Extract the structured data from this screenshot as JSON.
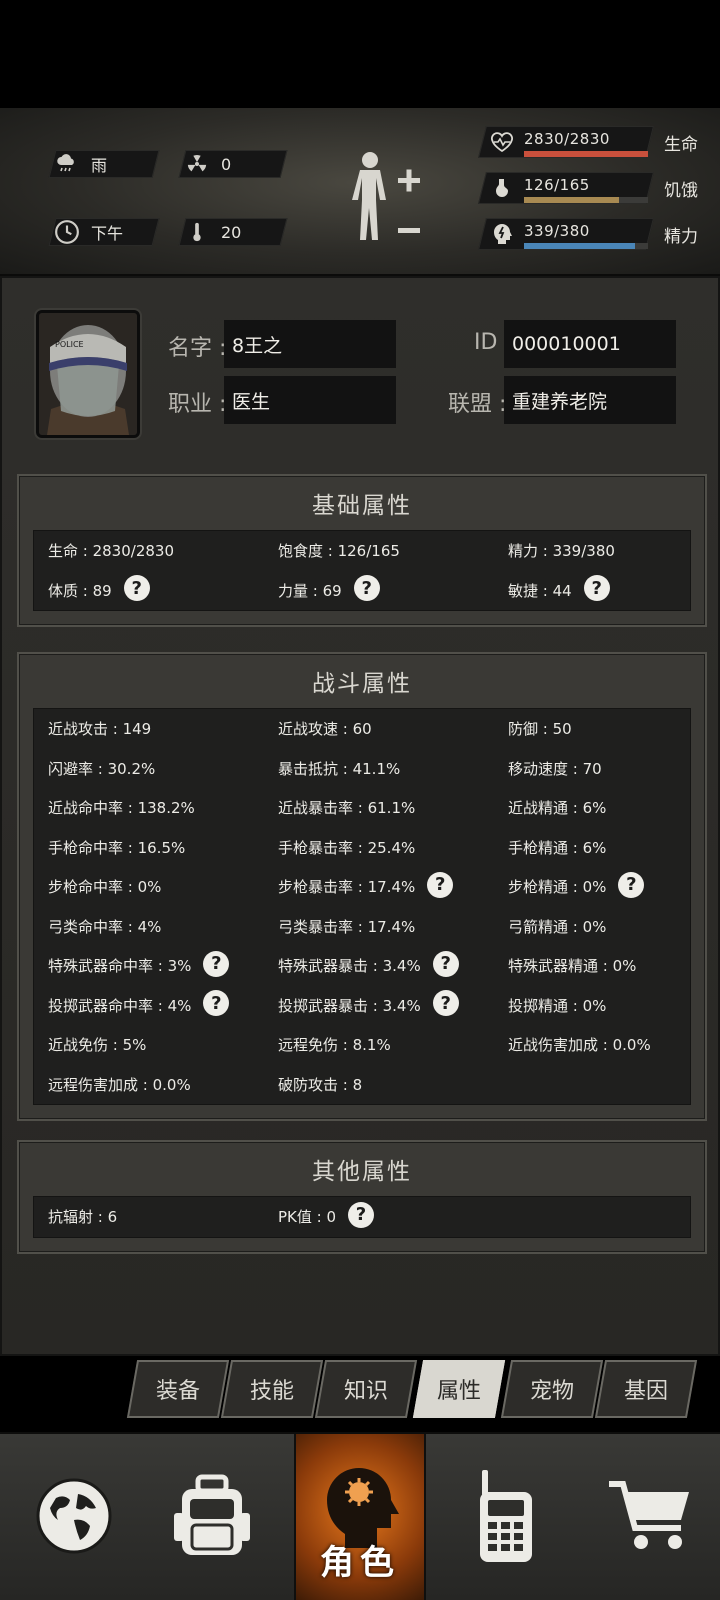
{
  "hud": {
    "weather": {
      "icon": "rain-cloud-icon",
      "value": "雨"
    },
    "radiation": {
      "icon": "radiation-icon",
      "value": "0"
    },
    "time": {
      "icon": "clock-icon",
      "value": "下午"
    },
    "temperature": {
      "icon": "thermometer-icon",
      "value": "20"
    },
    "stats": [
      {
        "icon": "heart-pulse-icon",
        "value": "2830/2830",
        "label": "生命",
        "current": 2830,
        "max": 2830,
        "color": "#c9503c"
      },
      {
        "icon": "stomach-icon",
        "value": "126/165",
        "label": "饥饿",
        "current": 126,
        "max": 165,
        "color": "#a88a52"
      },
      {
        "icon": "energy-head-icon",
        "value": "339/380",
        "label": "精力",
        "current": 339,
        "max": 380,
        "color": "#4a86b8"
      }
    ]
  },
  "profile": {
    "name_label": "名字",
    "name": "8王之",
    "id_label": "ID",
    "id": "000010001",
    "job_label": "职业",
    "job": "医生",
    "alliance_label": "联盟",
    "alliance": "重建养老院"
  },
  "basic": {
    "title": "基础属性",
    "rows": [
      [
        {
          "text": "生命 : 2830/2830",
          "help": false
        },
        {
          "text": "饱食度 : 126/165",
          "help": false
        },
        {
          "text": "精力 : 339/380",
          "help": false
        }
      ],
      [
        {
          "text": "体质 : 89",
          "help": true
        },
        {
          "text": "力量 : 69",
          "help": true
        },
        {
          "text": "敏捷 : 44",
          "help": true
        }
      ]
    ]
  },
  "combat": {
    "title": "战斗属性",
    "rows": [
      [
        {
          "text": "近战攻击 : 149",
          "help": false
        },
        {
          "text": "近战攻速 : 60",
          "help": false
        },
        {
          "text": "防御 : 50",
          "help": false
        }
      ],
      [
        {
          "text": "闪避率 : 30.2%",
          "help": false
        },
        {
          "text": "暴击抵抗 : 41.1%",
          "help": false
        },
        {
          "text": "移动速度 : 70",
          "help": false
        }
      ],
      [
        {
          "text": "近战命中率 : 138.2%",
          "help": false
        },
        {
          "text": "近战暴击率 : 61.1%",
          "help": false
        },
        {
          "text": "近战精通 : 6%",
          "help": false
        }
      ],
      [
        {
          "text": "手枪命中率 : 16.5%",
          "help": false
        },
        {
          "text": "手枪暴击率 : 25.4%",
          "help": false
        },
        {
          "text": "手枪精通 : 6%",
          "help": false
        }
      ],
      [
        {
          "text": "步枪命中率 : 0%",
          "help": false
        },
        {
          "text": "步枪暴击率 : 17.4%",
          "help": true
        },
        {
          "text": "步枪精通 : 0%",
          "help": true
        }
      ],
      [
        {
          "text": "弓类命中率 : 4%",
          "help": false
        },
        {
          "text": "弓类暴击率 : 17.4%",
          "help": false
        },
        {
          "text": "弓箭精通 : 0%",
          "help": false
        }
      ],
      [
        {
          "text": "特殊武器命中率 : 3%",
          "help": true
        },
        {
          "text": "特殊武器暴击 : 3.4%",
          "help": true
        },
        {
          "text": "特殊武器精通 : 0%",
          "help": false
        }
      ],
      [
        {
          "text": "投掷武器命中率 : 4%",
          "help": true
        },
        {
          "text": "投掷武器暴击 : 3.4%",
          "help": true
        },
        {
          "text": "投掷精通 : 0%",
          "help": false
        }
      ],
      [
        {
          "text": "近战免伤 : 5%",
          "help": false
        },
        {
          "text": "远程免伤 : 8.1%",
          "help": false
        },
        {
          "text": "近战伤害加成 : 0.0%",
          "help": false
        }
      ],
      [
        {
          "text": "远程伤害加成 : 0.0%",
          "help": false
        },
        {
          "text": "破防攻击 : 8",
          "help": false
        },
        null
      ]
    ]
  },
  "other": {
    "title": "其他属性",
    "rows": [
      [
        {
          "text": "抗辐射 : 6",
          "help": false
        },
        {
          "text": "PK值 : 0",
          "help": true
        },
        null
      ]
    ]
  },
  "help_glyph": "?",
  "tabs": [
    {
      "label": "装备",
      "active": false
    },
    {
      "label": "技能",
      "active": false
    },
    {
      "label": "知识",
      "active": false
    },
    {
      "label": "属性",
      "active": true
    },
    {
      "label": "宠物",
      "active": false
    },
    {
      "label": "基因",
      "active": false
    }
  ],
  "nav": [
    {
      "icon": "globe-icon",
      "label": "",
      "active": false
    },
    {
      "icon": "backpack-icon",
      "label": "",
      "active": false
    },
    {
      "icon": "character-head-icon",
      "label": "角色",
      "active": true
    },
    {
      "icon": "walkie-talkie-icon",
      "label": "",
      "active": false
    },
    {
      "icon": "shopping-cart-icon",
      "label": "",
      "active": false
    }
  ]
}
